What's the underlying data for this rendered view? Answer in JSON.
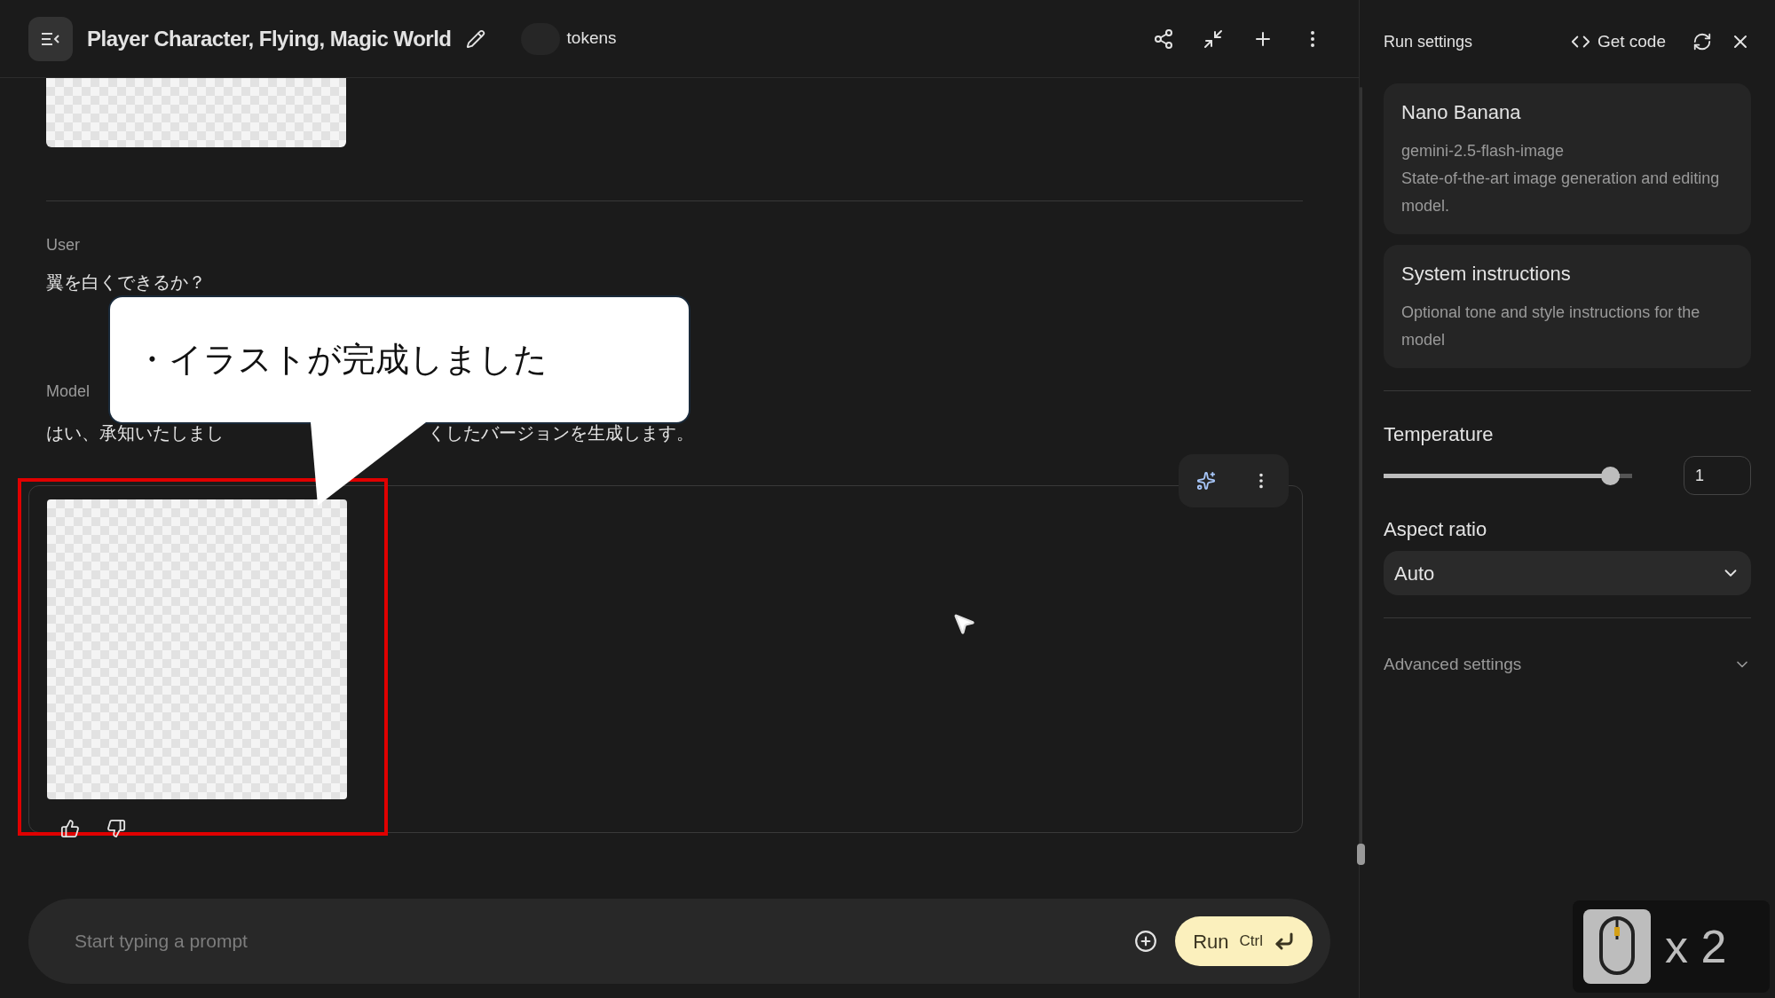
{
  "header": {
    "title": "Player Character, Flying, Magic World",
    "tokens": "tokens"
  },
  "chat": {
    "user": {
      "role": "User",
      "text": "翼を白くできるか？"
    },
    "model": {
      "role": "Model",
      "text_before": "はい、承知いたしまし",
      "text_after": "くしたバージョンを生成します。"
    }
  },
  "callout": {
    "text": "・イラストが完成しました"
  },
  "prompt": {
    "placeholder": "Start typing a prompt",
    "run": "Run",
    "shortcut": "Ctrl"
  },
  "settings": {
    "title": "Run settings",
    "get_code": "Get code",
    "model": {
      "name": "Nano Banana",
      "id": "gemini-2.5-flash-image",
      "description": "State-of-the-art image generation and editing model."
    },
    "system": {
      "title": "System instructions",
      "placeholder": "Optional tone and style instructions for the model"
    },
    "temperature": {
      "label": "Temperature",
      "level": 0.95,
      "value": "1"
    },
    "aspect": {
      "label": "Aspect ratio",
      "value": "Auto"
    },
    "advanced": {
      "label": "Advanced settings",
      "expanded": false
    }
  },
  "overlay": {
    "clicks": "x 2"
  }
}
